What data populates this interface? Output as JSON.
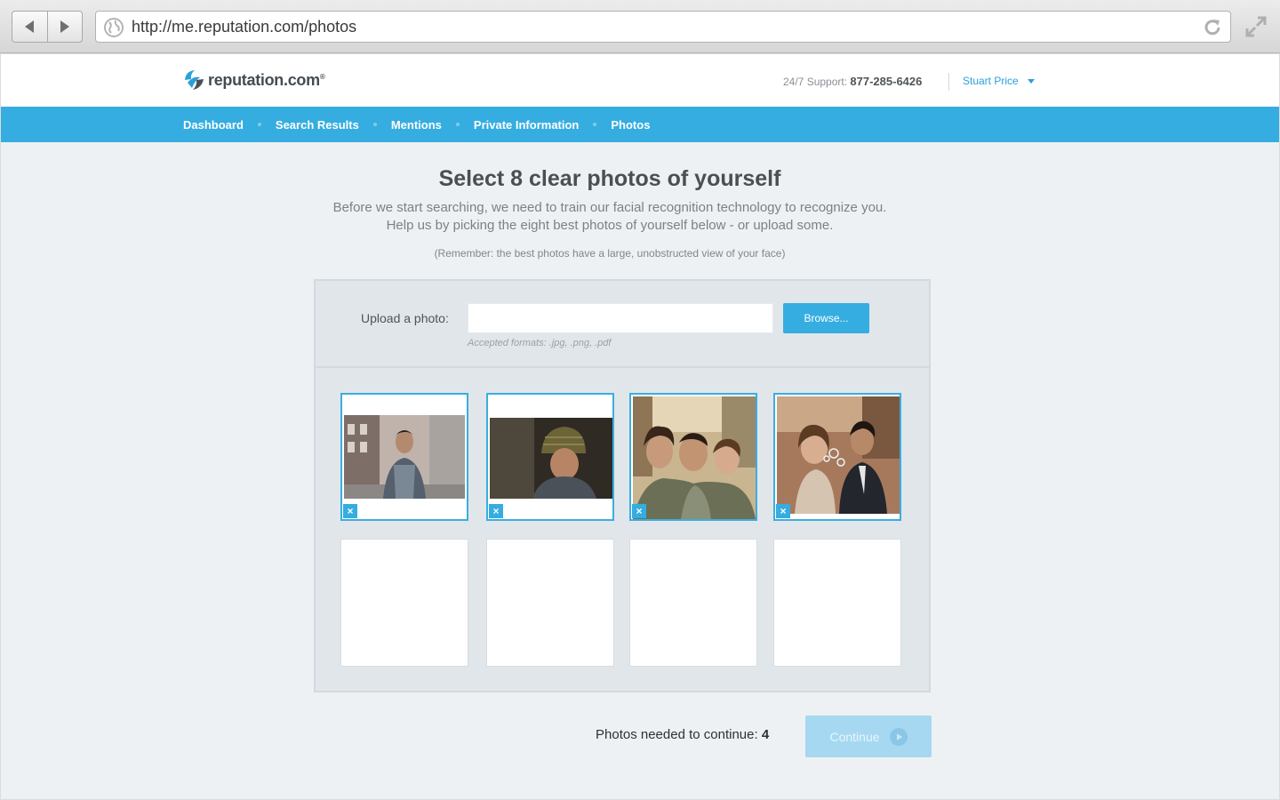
{
  "browser": {
    "url": "http://me.reputation.com/photos"
  },
  "header": {
    "logo_text": "reputation.com",
    "logo_reg": "®",
    "support_label": "24/7 Support:",
    "support_phone": "877-285-6426",
    "user_name": "Stuart Price"
  },
  "nav": {
    "items": [
      {
        "label": "Dashboard"
      },
      {
        "label": "Search Results"
      },
      {
        "label": "Mentions"
      },
      {
        "label": "Private Information"
      },
      {
        "label": "Photos"
      }
    ]
  },
  "main": {
    "title": "Select 8 clear photos of yourself",
    "subtitle_line1": "Before we start searching, we need to train our facial recognition technology to recognize you.",
    "subtitle_line2": "Help us by picking the eight best photos of yourself below - or upload some.",
    "note": "(Remember: the best photos have a large, unobstructed view of your face)"
  },
  "upload": {
    "label": "Upload a photo:",
    "input_value": "",
    "browse_label": "Browse...",
    "formats": "Accepted formats:  .jpg, .png, .pdf"
  },
  "photos": {
    "remove_glyph": "×",
    "filled_count": 4,
    "total_slots": 8
  },
  "footer": {
    "needed_label": "Photos needed to continue:",
    "needed_count": "4",
    "continue_label": "Continue"
  },
  "colors": {
    "accent": "#35ade0",
    "page_bg": "#eef1f3",
    "continue_disabled": "#a6d8f1"
  }
}
